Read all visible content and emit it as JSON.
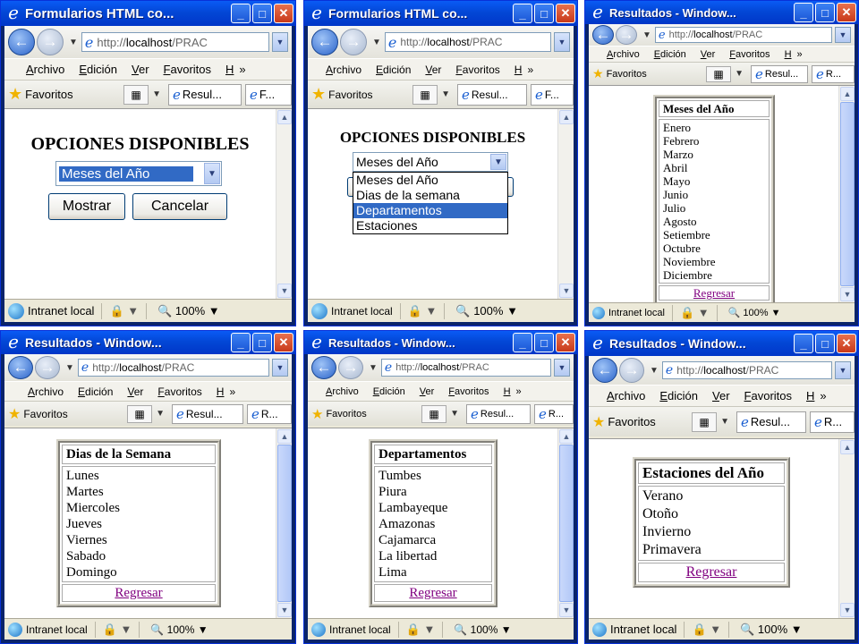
{
  "browser": {
    "address_prefix": "http://",
    "address_host": "localhost",
    "address_path": "/PRAC",
    "menu": [
      "Archivo",
      "Edición",
      "Ver",
      "Favoritos",
      "H"
    ],
    "menu_more": "»",
    "favorites_label": "Favoritos",
    "status_zone": "Intranet local",
    "zoom": "100%",
    "back_icon": "back-arrow-icon",
    "forward_icon": "forward-arrow-icon"
  },
  "windows": [
    {
      "title": "Formularios HTML co...",
      "tab1": "Resul...",
      "tab2": "F..."
    },
    {
      "title": "Formularios HTML co...",
      "tab1": "Resul...",
      "tab2": "F..."
    },
    {
      "title": "Resultados - Window...",
      "tab1": "Resul...",
      "tab2": "R..."
    },
    {
      "title": "Resultados - Window...",
      "tab1": "Resul...",
      "tab2": "R..."
    },
    {
      "title": "Resultados - Window...",
      "tab1": "Resul...",
      "tab2": "R..."
    },
    {
      "title": "Resultados - Window...",
      "tab1": "Resul...",
      "tab2": "R..."
    }
  ],
  "form": {
    "heading": "OPCIONES DISPONIBLES",
    "selected": "Meses del Año",
    "show_button": "Mostrar",
    "cancel_button": "Cancelar",
    "options": [
      "Meses del Año",
      "Dias de la semana",
      "Departamentos",
      "Estaciones"
    ],
    "highlighted_option": "Departamentos"
  },
  "results": {
    "back_link": "Regresar",
    "months": {
      "header": "Meses del Año",
      "items": [
        "Enero",
        "Febrero",
        "Marzo",
        "Abril",
        "Mayo",
        "Junio",
        "Julio",
        "Agosto",
        "Setiembre",
        "Octubre",
        "Noviembre",
        "Diciembre"
      ]
    },
    "days": {
      "header": "Dias de la Semana",
      "items": [
        "Lunes",
        "Martes",
        "Miercoles",
        "Jueves",
        "Viernes",
        "Sabado",
        "Domingo"
      ]
    },
    "departments": {
      "header": "Departamentos",
      "items": [
        "Tumbes",
        "Piura",
        "Lambayeque",
        "Amazonas",
        "Cajamarca",
        "La libertad",
        "Lima"
      ]
    },
    "seasons": {
      "header": "Estaciones del Año",
      "items": [
        "Verano",
        "Otoño",
        "Invierno",
        "Primavera"
      ]
    }
  },
  "colors": {
    "titlebar": "#0347d6",
    "highlight": "#316ac5",
    "link": "#800080"
  }
}
